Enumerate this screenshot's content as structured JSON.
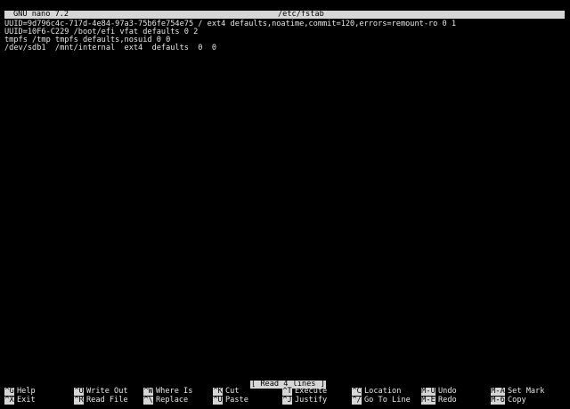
{
  "header": {
    "app_name": "GNU nano 7.2",
    "file_name": "/etc/fstab"
  },
  "editor": {
    "lines": [
      "UUID=9d796c4c-717d-4e84-97a3-75b6fe754e75 / ext4 defaults,noatime,commit=120,errors=remount-ro 0 1",
      "UUID=10F6-C229 /boot/efi vfat defaults 0 2",
      "tmpfs /tmp tmpfs defaults,nosuid 0 0",
      "/dev/sdb1  /mnt/internal  ext4  defaults  0  0"
    ]
  },
  "status": {
    "message": "[ Read 4 lines ]"
  },
  "shortcuts": {
    "row1": [
      {
        "key": "^G",
        "label": "Help"
      },
      {
        "key": "^O",
        "label": "Write Out"
      },
      {
        "key": "^W",
        "label": "Where Is"
      },
      {
        "key": "^K",
        "label": "Cut"
      },
      {
        "key": "^T",
        "label": "Execute"
      },
      {
        "key": "^C",
        "label": "Location"
      },
      {
        "key": "M-U",
        "label": "Undo"
      },
      {
        "key": "M-A",
        "label": "Set Mark"
      }
    ],
    "row2": [
      {
        "key": "^X",
        "label": "Exit"
      },
      {
        "key": "^R",
        "label": "Read File"
      },
      {
        "key": "^\\",
        "label": "Replace"
      },
      {
        "key": "^U",
        "label": "Paste"
      },
      {
        "key": "^J",
        "label": "Justify"
      },
      {
        "key": "^/",
        "label": "Go To Line"
      },
      {
        "key": "M-E",
        "label": "Redo"
      },
      {
        "key": "M-6",
        "label": "Copy"
      }
    ]
  },
  "colors": {
    "background": "#000000",
    "foreground": "#e6e6e6",
    "inverse_bg": "#d6d6d6",
    "inverse_fg": "#000000"
  }
}
